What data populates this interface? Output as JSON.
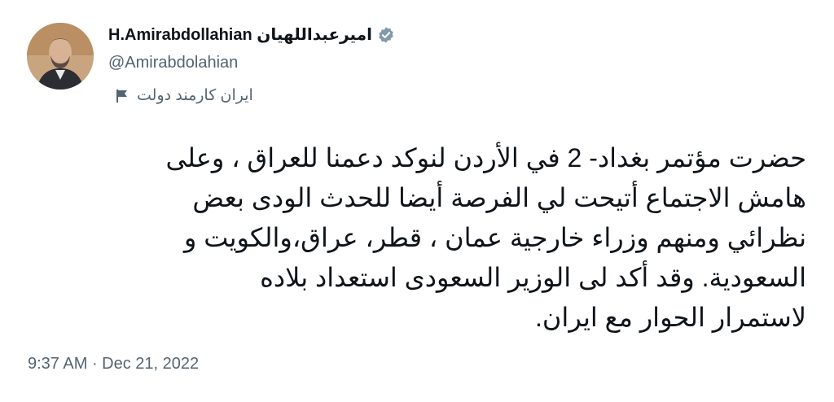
{
  "author": {
    "display_name": "H.Amirabdollahian اميرعبداللهيان",
    "handle": "@Amirabdolahian",
    "account_label": "ایران کارمند دولت",
    "verified_icon": "verified-badge-icon",
    "label_icon": "flag-icon"
  },
  "tweet": {
    "text": "حضرت مؤتمر بغداد- 2 في الأردن لنوكد دعمنا للعراق ، وعلى\nهامش الاجتماع أتيحت لي الفرصة أيضا للحدث الودى بعض\nنظرائي ومنهم وزراء خارجية عمان ، قطر، عراق،والكويت و\nالسعودية. وقد أكد لى الوزير السعودى استعداد بلاده\nلاستمرار الحوار مع ايران.",
    "time": "9:37 AM",
    "separator": " · ",
    "date": "Dec 21, 2022"
  },
  "colors": {
    "text": "#0f1419",
    "secondary": "#536471",
    "verified_badge": "#829aab"
  }
}
